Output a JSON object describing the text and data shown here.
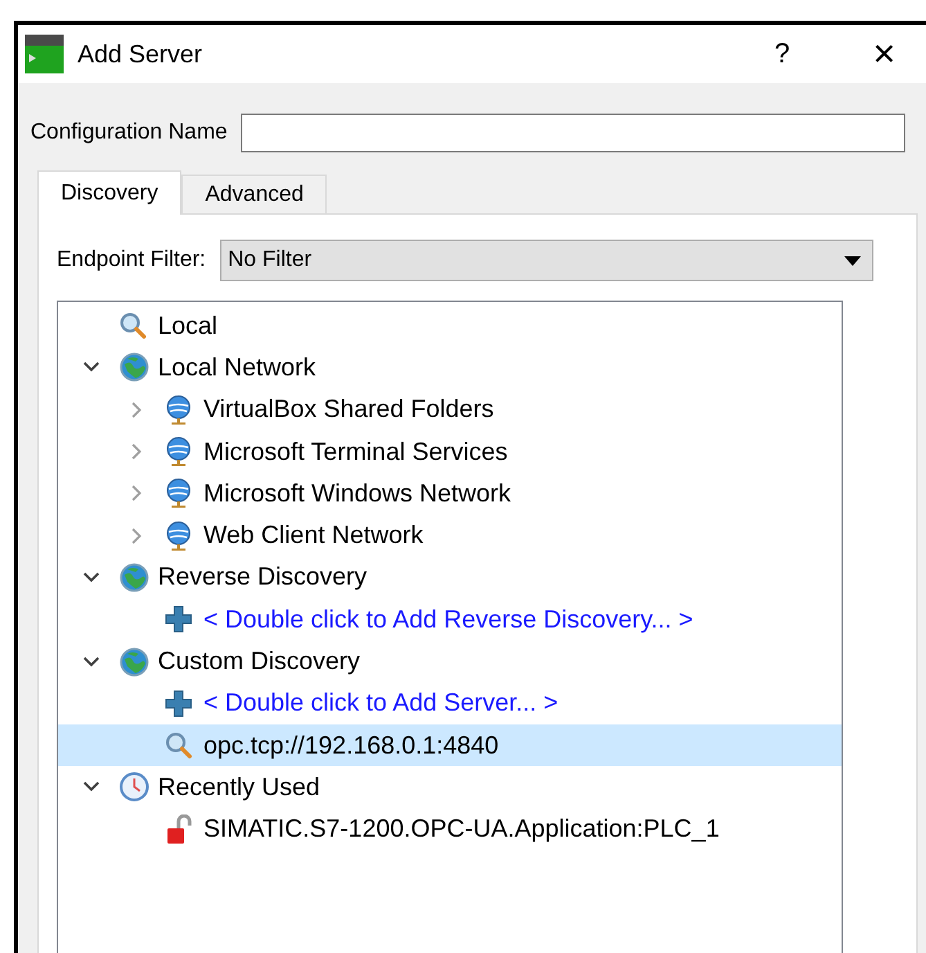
{
  "window": {
    "title": "Add Server",
    "help_button": "?",
    "close_button": "×"
  },
  "configuration_name": {
    "label": "Configuration Name"
  },
  "tabs": [
    {
      "label": "Discovery",
      "selected": true
    },
    {
      "label": "Advanced",
      "selected": false
    }
  ],
  "endpoint_filter": {
    "label": "Endpoint Filter:",
    "value": "No Filter"
  },
  "tree": [
    {
      "label": "Local",
      "kind": "search",
      "selected": false
    },
    {
      "label": "Local Network",
      "kind": "network",
      "selected": false,
      "expanded": true,
      "children": [
        {
          "label": "VirtualBox Shared Folders",
          "kind": "host",
          "selected": false,
          "expanded": false
        },
        {
          "label": "Microsoft Terminal Services",
          "kind": "host",
          "selected": false,
          "expanded": false
        },
        {
          "label": "Microsoft Windows Network",
          "kind": "host",
          "selected": false,
          "expanded": false
        },
        {
          "label": "Web Client Network",
          "kind": "host",
          "selected": false,
          "expanded": false
        }
      ]
    },
    {
      "label": "Reverse Discovery",
      "kind": "network",
      "selected": false,
      "expanded": true,
      "children": [
        {
          "label": "< Double click to Add Reverse Discovery... >",
          "kind": "add",
          "selected": false
        }
      ]
    },
    {
      "label": "Custom Discovery",
      "kind": "network",
      "selected": false,
      "expanded": true,
      "children": [
        {
          "label": "< Double click to Add Server... >",
          "kind": "add",
          "selected": false
        },
        {
          "label": "opc.tcp://192.168.0.1:4840",
          "kind": "search",
          "selected": true
        }
      ]
    },
    {
      "label": "Recently Used",
      "kind": "history",
      "selected": false,
      "expanded": true,
      "children": [
        {
          "label": "SIMATIC.S7-1200.OPC-UA.Application:PLC_1",
          "kind": "locked",
          "selected": false
        }
      ]
    }
  ]
}
